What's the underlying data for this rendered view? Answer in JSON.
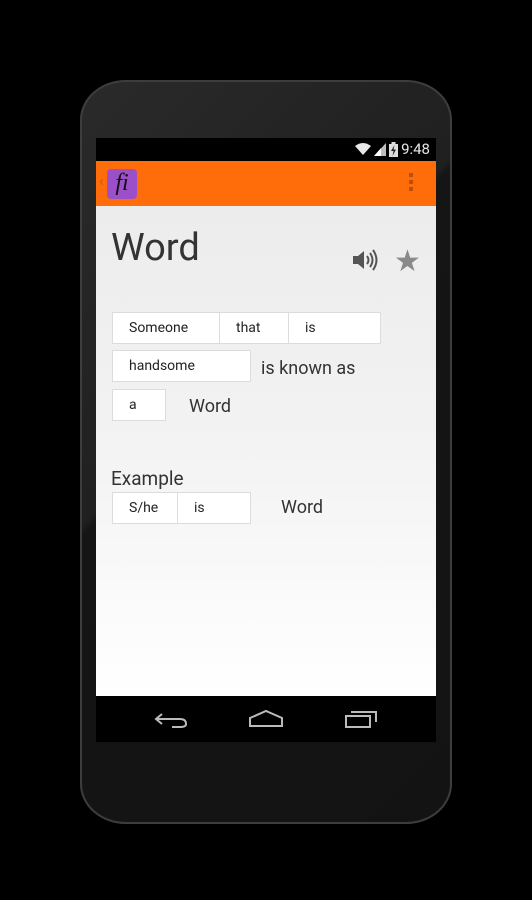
{
  "status_bar": {
    "time": "9:48",
    "icons": [
      "wifi-icon",
      "signal-icon",
      "battery-charging-icon"
    ]
  },
  "action_bar": {
    "logo_text": "fi",
    "up_caret": "‹",
    "overflow_icon": "overflow-menu-icon",
    "colors": {
      "bar": "#ff6d0a",
      "logo": "#9b4fc8"
    }
  },
  "main": {
    "word_title": "Word",
    "speaker_icon": "speaker-icon",
    "star_icon": "star-icon",
    "star_glyph": "★",
    "definition": {
      "boxes": [
        "Someone",
        "that",
        "is",
        "handsome",
        "a"
      ],
      "texts": [
        "is known as",
        "Word"
      ]
    },
    "example": {
      "label": "Example",
      "boxes": [
        "S/he",
        "is"
      ],
      "word": "Word"
    }
  },
  "nav_bar": {
    "buttons": [
      "back-icon",
      "home-icon",
      "recents-icon"
    ]
  }
}
